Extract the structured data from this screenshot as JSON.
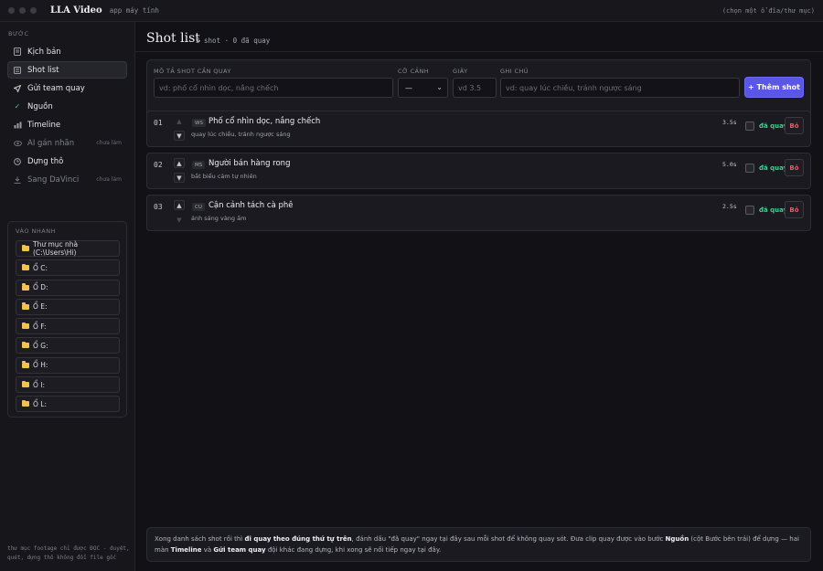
{
  "app": {
    "title": "LLA Video",
    "subtitle": "app máy tính",
    "top_right_hint": "(chọn một ổ đĩa/thư mục)"
  },
  "sidebar": {
    "steps_label": "Bước",
    "items": [
      {
        "label": "Kịch bản",
        "icon": "document-icon",
        "active": false,
        "dim": false,
        "badge": ""
      },
      {
        "label": "Shot list",
        "icon": "list-icon",
        "active": true,
        "dim": false,
        "badge": ""
      },
      {
        "label": "Gửi team quay",
        "icon": "send-icon",
        "active": false,
        "dim": false,
        "badge": ""
      },
      {
        "label": "Nguồn",
        "icon": "check-icon",
        "active": false,
        "dim": false,
        "badge": ""
      },
      {
        "label": "Timeline",
        "icon": "timeline-icon",
        "active": false,
        "dim": false,
        "badge": ""
      },
      {
        "label": "AI gán nhãn",
        "icon": "eye-icon",
        "active": false,
        "dim": true,
        "badge": "chưa làm"
      },
      {
        "label": "Dựng thô",
        "icon": "clock-icon",
        "active": false,
        "dim": false,
        "badge": ""
      },
      {
        "label": "Sang DaVinci",
        "icon": "download-icon",
        "active": false,
        "dim": true,
        "badge": "chưa làm"
      }
    ],
    "quick": {
      "label": "Vào nhanh",
      "items": [
        "Thư mục nhà (C:\\Users\\Hi)",
        "Ổ C:",
        "Ổ D:",
        "Ổ E:",
        "Ổ F:",
        "Ổ G:",
        "Ổ H:",
        "Ổ I:",
        "Ổ L:"
      ]
    },
    "footer": "thư mục footage chỉ được ĐỌC - duyệt, quét, dựng thô không đổi file gốc"
  },
  "page": {
    "title": "Shot list",
    "meta": "3 shot · 0 đã quay"
  },
  "form": {
    "desc_label": "Mô tả shot cần quay",
    "desc_placeholder": "vd: phố cổ nhìn dọc, nắng chếch",
    "size_label": "Cỡ cảnh",
    "size_value": "—",
    "sec_label": "Giây",
    "sec_placeholder": "vd 3.5",
    "note_label": "Ghi chú",
    "note_placeholder": "vd: quay lúc chiều, tránh ngược sáng",
    "add_label": "+ Thêm shot"
  },
  "shots": [
    {
      "num": "01",
      "tag": "WS",
      "title": "Phố cổ nhìn dọc, nắng chếch",
      "note": "quay lúc chiều, tránh ngược sáng",
      "duration": "3.5s",
      "done_label": "đã quay",
      "remove_label": "Bỏ"
    },
    {
      "num": "02",
      "tag": "MS",
      "title": "Người bán hàng rong",
      "note": "bắt biểu cảm tự nhiên",
      "duration": "5.0s",
      "done_label": "đã quay",
      "remove_label": "Bỏ"
    },
    {
      "num": "03",
      "tag": "CU",
      "title": "Cận cảnh tách cà phê",
      "note": "ánh sáng vàng ấm",
      "duration": "2.5s",
      "done_label": "đã quay",
      "remove_label": "Bỏ"
    }
  ],
  "info": {
    "t1": "Xong danh sách shot rồi thì ",
    "b1": "đi quay theo đúng thứ tự trên",
    "t2": ", đánh dấu \"đã quay\" ngay tại đây sau mỗi shot để không quay sót. Đưa clip quay được vào bước ",
    "b2": "Nguồn",
    "t3": " (cột Bước bên trái) để dựng — hai màn ",
    "b3": "Timeline",
    "t4": " và ",
    "b4": "Gửi team quay",
    "t5": " đội khác đang dựng, khi xong sẽ nối tiếp ngay tại đây."
  }
}
